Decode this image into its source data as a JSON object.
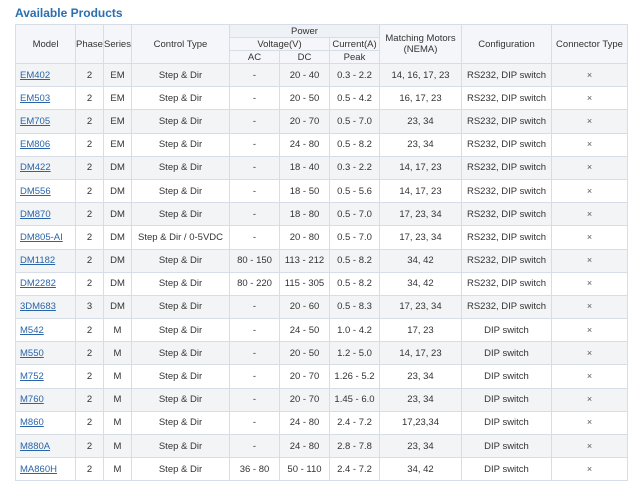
{
  "heading": "Available Products",
  "header": {
    "model": "Model",
    "phase": "Phase",
    "series": "Series",
    "control_type": "Control Type",
    "power": "Power",
    "voltage": "Voltage(V)",
    "current": "Current(A)",
    "ac": "AC",
    "dc": "DC",
    "peak": "Peak",
    "motors_line1": "Matching Motors",
    "motors_line2": "(NEMA)",
    "configuration": "Configuration",
    "connector_type": "Connector Type"
  },
  "rows": [
    {
      "model": "EM402",
      "phase": "2",
      "series": "EM",
      "control": "Step & Dir",
      "ac": "-",
      "dc": "20 - 40",
      "peak": "0.3 - 2.2",
      "motors": "14, 16, 17, 23",
      "config": "RS232, DIP switch",
      "connector": "×"
    },
    {
      "model": "EM503",
      "phase": "2",
      "series": "EM",
      "control": "Step & Dir",
      "ac": "-",
      "dc": "20 - 50",
      "peak": "0.5 - 4.2",
      "motors": "16, 17, 23",
      "config": "RS232, DIP switch",
      "connector": "×"
    },
    {
      "model": "EM705",
      "phase": "2",
      "series": "EM",
      "control": "Step & Dir",
      "ac": "-",
      "dc": "20 - 70",
      "peak": "0.5 - 7.0",
      "motors": "23, 34",
      "config": "RS232, DIP switch",
      "connector": "×"
    },
    {
      "model": "EM806",
      "phase": "2",
      "series": "EM",
      "control": "Step & Dir",
      "ac": "-",
      "dc": "24 - 80",
      "peak": "0.5 - 8.2",
      "motors": "23, 34",
      "config": "RS232, DIP switch",
      "connector": "×"
    },
    {
      "model": "DM422",
      "phase": "2",
      "series": "DM",
      "control": "Step & Dir",
      "ac": "-",
      "dc": "18 - 40",
      "peak": "0.3 - 2.2",
      "motors": "14, 17, 23",
      "config": "RS232, DIP switch",
      "connector": "×"
    },
    {
      "model": "DM556",
      "phase": "2",
      "series": "DM",
      "control": "Step & Dir",
      "ac": "-",
      "dc": "18 - 50",
      "peak": "0.5 - 5.6",
      "motors": "14, 17, 23",
      "config": "RS232, DIP switch",
      "connector": "×"
    },
    {
      "model": "DM870",
      "phase": "2",
      "series": "DM",
      "control": "Step & Dir",
      "ac": "-",
      "dc": "18 - 80",
      "peak": "0.5 - 7.0",
      "motors": "17, 23, 34",
      "config": "RS232, DIP switch",
      "connector": "×"
    },
    {
      "model": "DM805-AI",
      "phase": "2",
      "series": "DM",
      "control": "Step & Dir / 0-5VDC",
      "ac": "-",
      "dc": "20 - 80",
      "peak": "0.5 - 7.0",
      "motors": "17, 23, 34",
      "config": "RS232, DIP switch",
      "connector": "×"
    },
    {
      "model": "DM1182",
      "phase": "2",
      "series": "DM",
      "control": "Step & Dir",
      "ac": "80 - 150",
      "dc": "113 - 212",
      "peak": "0.5 - 8.2",
      "motors": "34, 42",
      "config": "RS232, DIP switch",
      "connector": "×"
    },
    {
      "model": "DM2282",
      "phase": "2",
      "series": "DM",
      "control": "Step & Dir",
      "ac": "80 - 220",
      "dc": "115 - 305",
      "peak": "0.5 - 8.2",
      "motors": "34, 42",
      "config": "RS232, DIP switch",
      "connector": "×"
    },
    {
      "model": "3DM683",
      "phase": "3",
      "series": "DM",
      "control": "Step & Dir",
      "ac": "-",
      "dc": "20 - 60",
      "peak": "0.5 - 8.3",
      "motors": "17, 23, 34",
      "config": "RS232, DIP switch",
      "connector": "×"
    },
    {
      "model": "M542",
      "phase": "2",
      "series": "M",
      "control": "Step & Dir",
      "ac": "-",
      "dc": "24 - 50",
      "peak": "1.0 - 4.2",
      "motors": "17, 23",
      "config": "DIP switch",
      "connector": "×"
    },
    {
      "model": "M550",
      "phase": "2",
      "series": "M",
      "control": "Step & Dir",
      "ac": "-",
      "dc": "20 - 50",
      "peak": "1.2 - 5.0",
      "motors": "14, 17, 23",
      "config": "DIP switch",
      "connector": "×"
    },
    {
      "model": "M752",
      "phase": "2",
      "series": "M",
      "control": "Step & Dir",
      "ac": "-",
      "dc": "20 - 70",
      "peak": "1.26 - 5.2",
      "motors": "23, 34",
      "config": "DIP switch",
      "connector": "×"
    },
    {
      "model": "M760",
      "phase": "2",
      "series": "M",
      "control": "Step & Dir",
      "ac": "-",
      "dc": "20 - 70",
      "peak": "1.45 - 6.0",
      "motors": "23, 34",
      "config": "DIP switch",
      "connector": "×"
    },
    {
      "model": "M860",
      "phase": "2",
      "series": "M",
      "control": "Step & Dir",
      "ac": "-",
      "dc": "24 - 80",
      "peak": "2.4 - 7.2",
      "motors": "17,23,34",
      "config": "DIP switch",
      "connector": "×"
    },
    {
      "model": "M880A",
      "phase": "2",
      "series": "M",
      "control": "Step & Dir",
      "ac": "-",
      "dc": "24 - 80",
      "peak": "2.8 - 7.8",
      "motors": "23, 34",
      "config": "DIP switch",
      "connector": "×"
    },
    {
      "model": "MA860H",
      "phase": "2",
      "series": "M",
      "control": "Step & Dir",
      "ac": "36 - 80",
      "dc": "50 - 110",
      "peak": "2.4 - 7.2",
      "motors": "34, 42",
      "config": "DIP switch",
      "connector": "×"
    }
  ]
}
